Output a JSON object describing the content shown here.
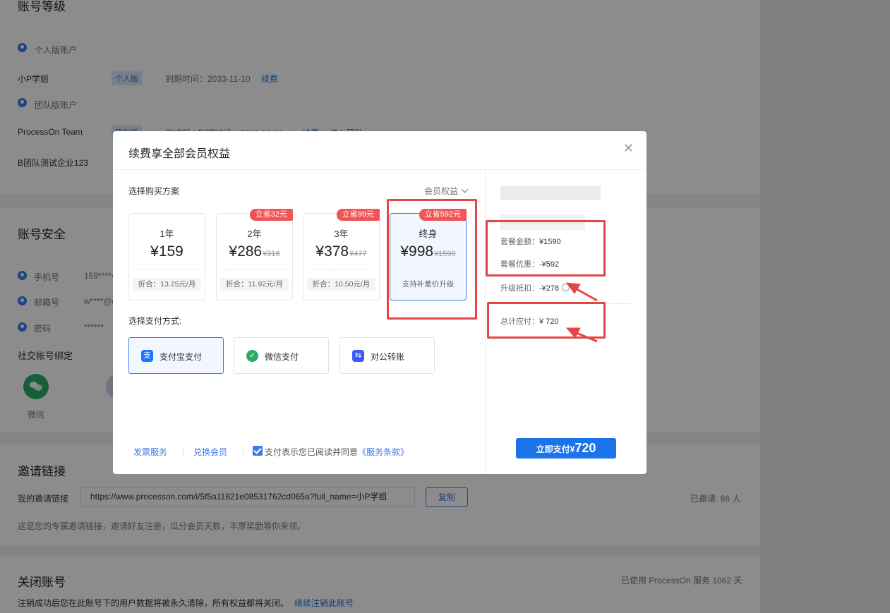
{
  "page": {
    "level": {
      "title": "账号等级",
      "personal_label": "个人版账户",
      "personal_name": "小P学姐",
      "personal_tag": "个人版",
      "personal_expire": "到期时间：2033-11-10",
      "personal_renew": "续费",
      "team_label": "团队版账户",
      "team1_name": "ProcessOn Team",
      "team1_tag": "团队版",
      "team1_info": "正式版 | 到期时间：2033-12-10",
      "team1_renew": "续费",
      "team1_enter": "进入团队",
      "team2_name": "B团队测试企业123"
    },
    "security": {
      "title": "账号安全",
      "phone_label": "手机号",
      "phone_value": "159****4",
      "email_label": "邮箱号",
      "email_value": "w****@q",
      "password_label": "密码",
      "password_value": "******",
      "social_title": "社交帐号绑定",
      "wechat_label": "微信"
    },
    "invite": {
      "title": "邀请链接",
      "my_link_label": "我的邀请链接",
      "link_value": "https://www.processon.com/i/5f5a11821e08531762cd065a?full_name=小P学姐",
      "copy_button": "复制",
      "invited_count": "已邀请: 86 人",
      "description": "这是您的专属邀请链接，邀请好友注册，瓜分会员天数，丰厚奖励等你来领。"
    },
    "close": {
      "title": "关闭账号",
      "used_days": "已使用 ProcessOn 服务 1062 天",
      "warning": "注销成功后您在此账号下的用户数据将被永久清除，所有权益都将关闭。",
      "continue_link": "继续注销此账号"
    }
  },
  "modal": {
    "title": "续费享全部会员权益",
    "choose_plan_label": "选择购买方案",
    "benefits_link": "会员权益",
    "plans": [
      {
        "name": "1年",
        "price": "¥159",
        "original": "",
        "badge": "",
        "note": "折合：13.25元/月",
        "selected": false
      },
      {
        "name": "2年",
        "price": "¥286",
        "original": "¥318",
        "badge": "立省32元",
        "note": "折合：11.92元/月",
        "selected": false
      },
      {
        "name": "3年",
        "price": "¥378",
        "original": "¥477",
        "badge": "立省99元",
        "note": "折合：10.50元/月",
        "selected": false
      },
      {
        "name": "终身",
        "price": "¥998",
        "original": "¥1590",
        "badge": "立省592元",
        "note": "支持补差价升级",
        "selected": true
      }
    ],
    "payment_label": "选择支付方式:",
    "payments": [
      {
        "label": "支付宝支付",
        "icon": "alipay-icon",
        "color": "#1677ff",
        "glyph": "支"
      },
      {
        "label": "微信支付",
        "icon": "wechat-pay-icon",
        "color": "#2aae67",
        "glyph": "✓"
      },
      {
        "label": "对公转账",
        "icon": "bank-transfer-icon",
        "color": "#3d5afe",
        "glyph": "⇆"
      }
    ],
    "footer": {
      "invoice": "发票服务",
      "redeem": "兑换会员",
      "agree_text": "支付表示您已阅读并同意",
      "terms": "《服务条款》"
    },
    "summary": {
      "package_label": "套餐金额：",
      "package_value": "¥1590",
      "discount_label": "套餐优惠：",
      "discount_value": "-¥592",
      "upgrade_label": "升级抵扣：",
      "upgrade_value": "-¥278",
      "total_label": "总计应付：",
      "total_value": "¥ 720"
    },
    "pay_button": {
      "label": "立即支付¥",
      "amount": "720"
    }
  },
  "colors": {
    "accent": "#1a73e8",
    "badge": "#f05454",
    "annotation": "#e54545"
  }
}
